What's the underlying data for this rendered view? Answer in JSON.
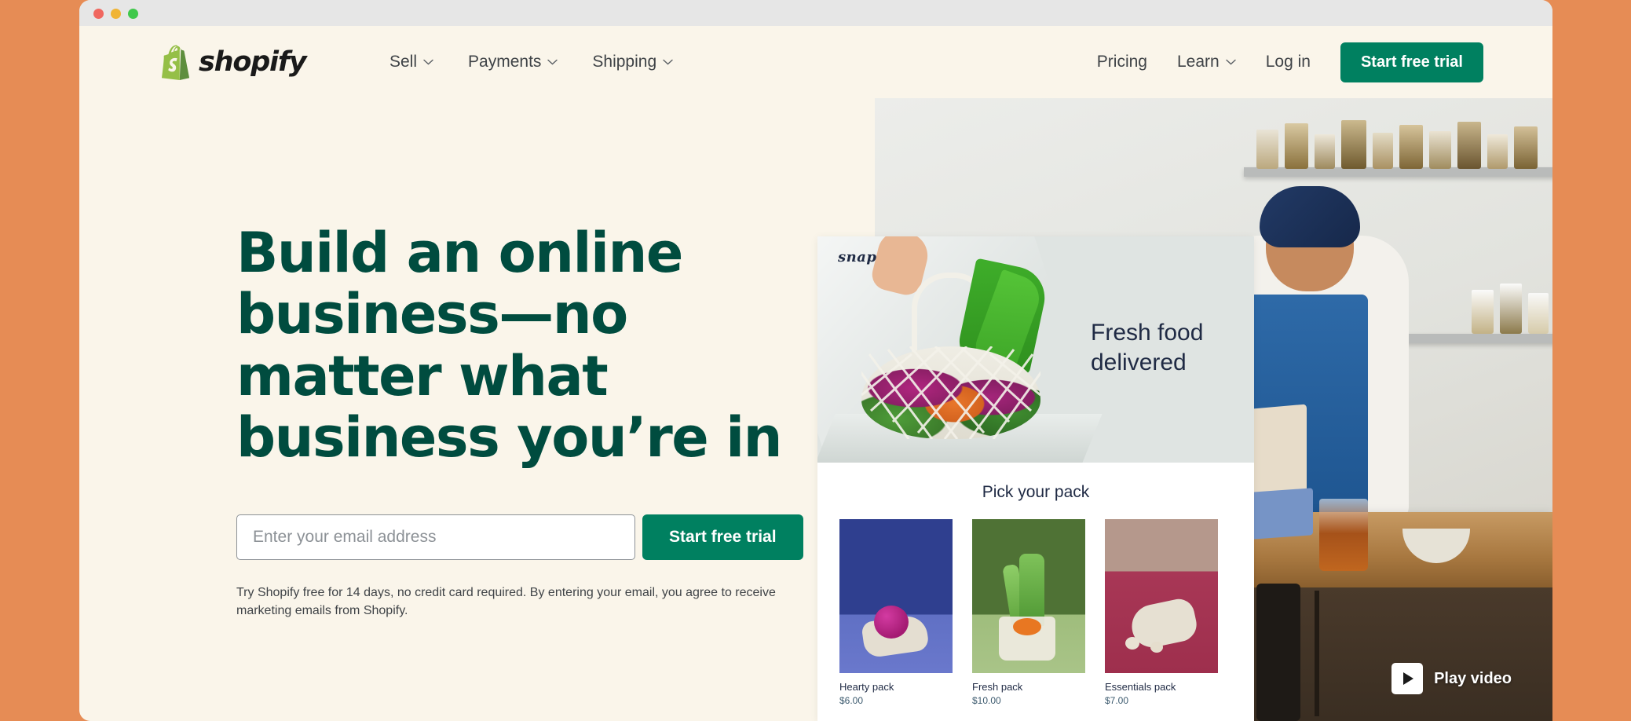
{
  "window": {
    "chrome_bg": "#E6E6E6",
    "desktop_bg": "#E68C55",
    "page_bg": "#FAF5EA"
  },
  "brand": {
    "name": "shopify",
    "green": "#008060",
    "dark_green": "#004C3F",
    "logo_icon": "shopify-bag-icon"
  },
  "nav": {
    "left_items": [
      {
        "label": "Sell",
        "has_dropdown": true
      },
      {
        "label": "Payments",
        "has_dropdown": true
      },
      {
        "label": "Shipping",
        "has_dropdown": true
      }
    ],
    "right_items": [
      {
        "label": "Pricing",
        "has_dropdown": false
      },
      {
        "label": "Learn",
        "has_dropdown": true
      },
      {
        "label": "Log in",
        "has_dropdown": false
      }
    ],
    "cta_label": "Start free trial"
  },
  "hero": {
    "headline": "Build an online business—no matter what business you’re in",
    "email_placeholder": "Enter your email address",
    "email_value": "",
    "cta_label": "Start free trial",
    "disclaimer": "Try Shopify free for 14 days, no credit card required. By entering your email, you agree to receive marketing emails from Shopify."
  },
  "store_preview": {
    "logo": "snap",
    "banner_title": "Fresh food delivered",
    "section_title": "Pick your pack",
    "products": [
      {
        "name": "Hearty pack",
        "price": "$6.00",
        "swatch": "#2F3F8F"
      },
      {
        "name": "Fresh pack",
        "price": "$10.00",
        "swatch": "#4F7235"
      },
      {
        "name": "Essentials pack",
        "price": "$7.00",
        "swatch": "#A83756"
      }
    ]
  },
  "video": {
    "label": "Play video",
    "icon": "play-icon"
  }
}
